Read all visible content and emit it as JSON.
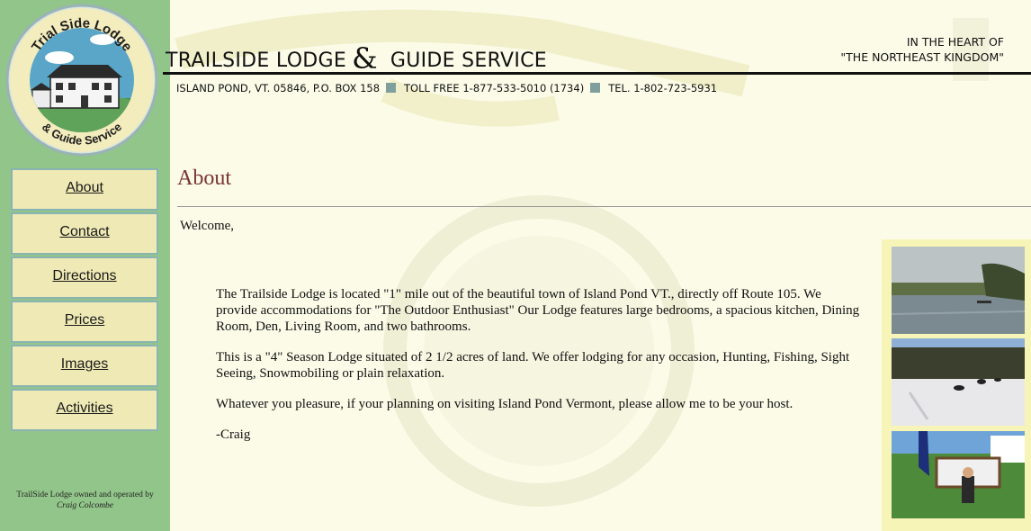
{
  "header": {
    "title_left": "TRAILSIDE LODGE",
    "title_amp": "&",
    "title_right": "GUIDE SERVICE",
    "tagline_line1": "IN THE HEART OF",
    "tagline_line2": "\"THE NORTHEAST KINGDOM\"",
    "address": "ISLAND POND, VT. 05846, P.O. BOX 158",
    "toll_free": "TOLL FREE 1-877-533-5010 (1734)",
    "tel": "TEL. 1-802-723-5931"
  },
  "logo": {
    "top_text": "Trial Side Lodge",
    "bottom_text": "& Guide Service"
  },
  "nav": {
    "items": [
      {
        "label": "About"
      },
      {
        "label": "Contact"
      },
      {
        "label": "Directions"
      },
      {
        "label": "Prices"
      },
      {
        "label": "Images"
      },
      {
        "label": "Activities"
      }
    ]
  },
  "footer": {
    "credit_line1": "TrailSide Lodge owned and operated by",
    "credit_line2": "Craig Colcombe"
  },
  "main": {
    "page_title": "About",
    "welcome": "Welcome,",
    "paragraphs": [
      "The Trailside Lodge is located \"1\" mile out of the beautiful town of Island Pond VT., directly off Route 105. We provide accommodations for \"The Outdoor Enthusiast\" Our Lodge features large bedrooms, a spacious kitchen, Dining Room, Den, Living Room, and two bathrooms.",
      "This is a \"4\" Season Lodge situated of 2 1/2 acres of land. We offer lodging for any occasion, Hunting, Fishing, Sight Seeing, Snowmobiling or plain relaxation.",
      "Whatever you pleasure, if your planning on visiting Island Pond Vermont, please allow me to be your host.",
      "-Craig"
    ]
  },
  "colors": {
    "sidebar": "#92c58a",
    "nav_bg": "#efeab5",
    "nav_border": "#8ab4b2",
    "page_bg": "#fbfbe8",
    "title": "#7a3430",
    "accent_square": "#7f9f9c"
  }
}
